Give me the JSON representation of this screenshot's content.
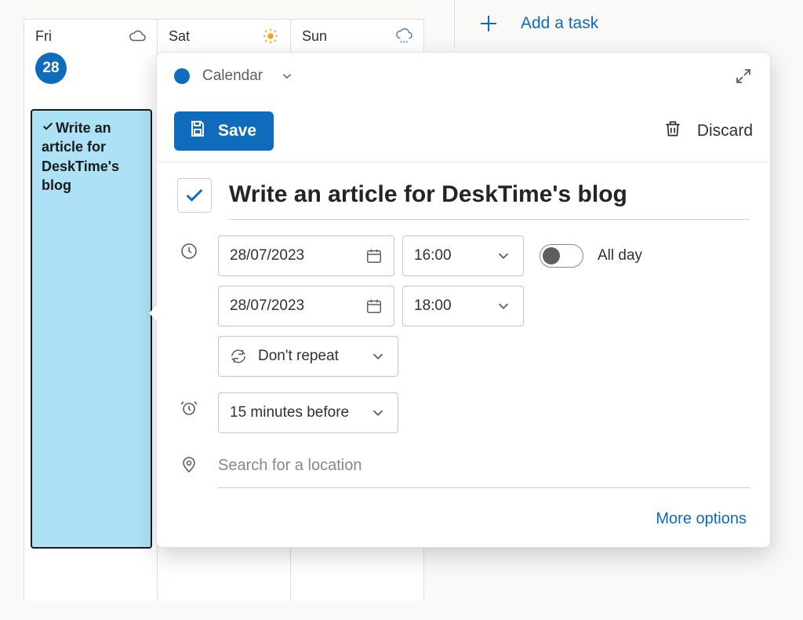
{
  "days": [
    {
      "label": "Fri",
      "date": "28",
      "weather": "cloud",
      "is_today": true
    },
    {
      "label": "Sat",
      "weather": "sun"
    },
    {
      "label": "Sun",
      "weather": "rain"
    }
  ],
  "event_block_title": "Write an article for DeskTime's blog",
  "task_panel": {
    "add_label": "Add a task"
  },
  "popup": {
    "calendar_name": "Calendar",
    "save_label": "Save",
    "discard_label": "Discard",
    "title": "Write an article for DeskTime's blog",
    "start_date": "28/07/2023",
    "start_time": "16:00",
    "end_date": "28/07/2023",
    "end_time": "18:00",
    "all_day_label": "All day",
    "repeat_label": "Don't repeat",
    "reminder_label": "15 minutes before",
    "location_placeholder": "Search for a location",
    "more_options_label": "More options"
  }
}
